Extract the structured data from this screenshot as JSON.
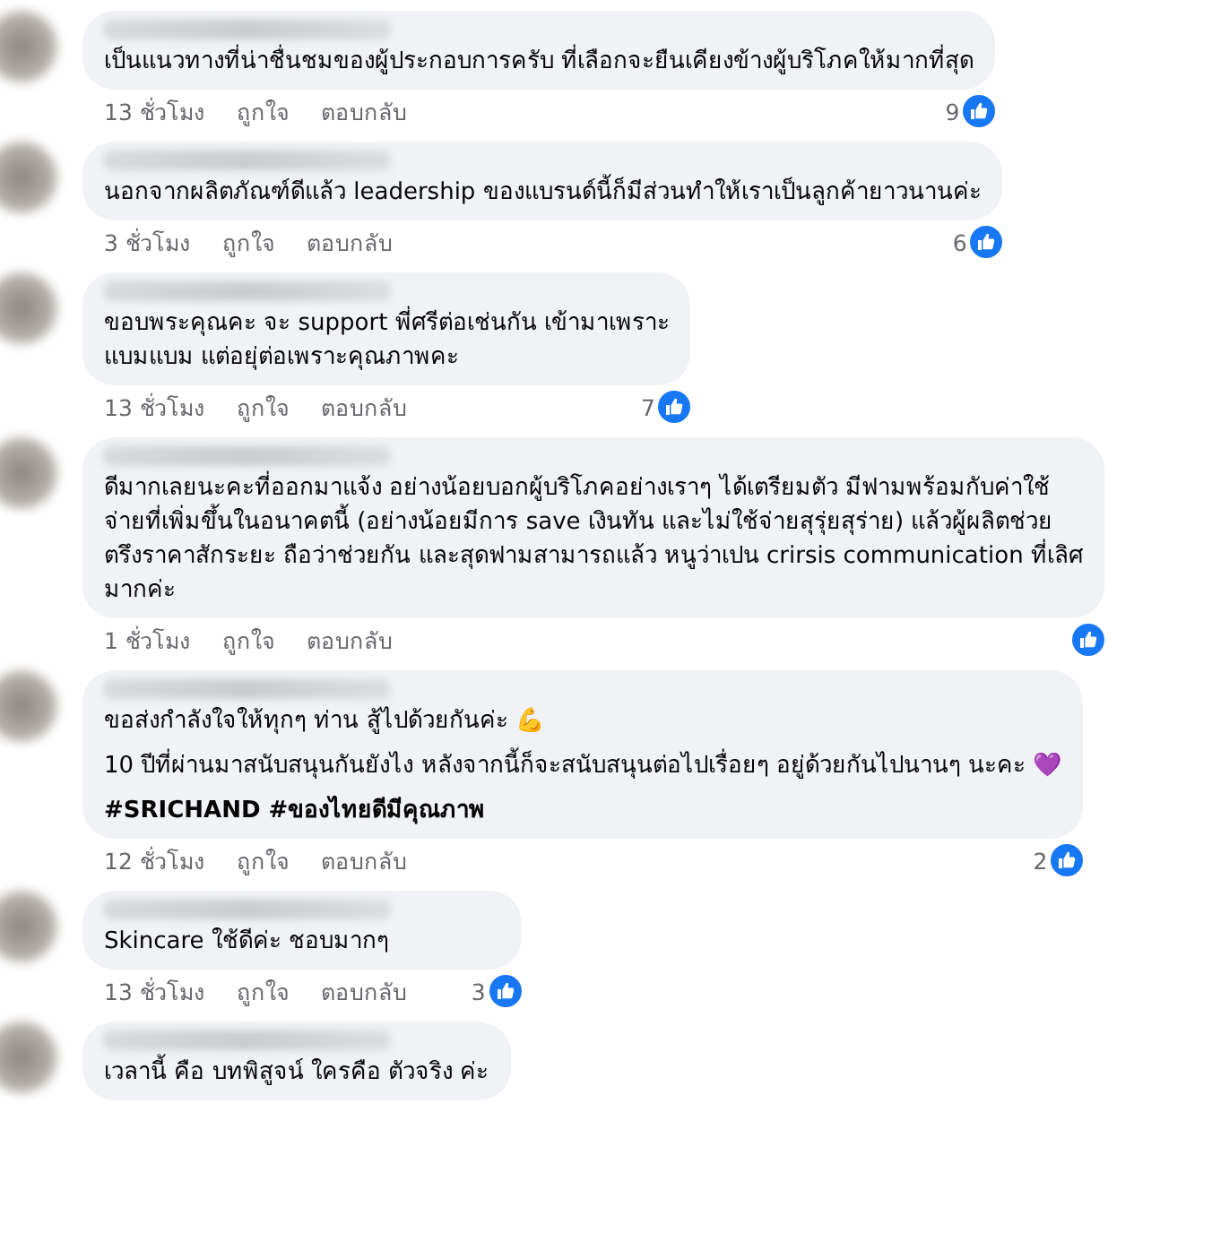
{
  "comments": [
    {
      "lines": [
        "เป็นแนวทางที่น่าชื่นชมของผู้ประกอบการครับ ที่เลือกจะยืนเคียงข้างผู้บริโภคให้มากที่สุด"
      ],
      "time": "13 ชั่วโมง",
      "like": "ถูกใจ",
      "reply": "ตอบกลับ",
      "likes": "9"
    },
    {
      "lines": [
        "นอกจากผลิตภัณฑ์ดีแล้ว leadership ของแบรนด์นี้ก็มีส่วนทำให้เราเป็นลูกค้ายาวนานค่ะ"
      ],
      "time": "3 ชั่วโมง",
      "like": "ถูกใจ",
      "reply": "ตอบกลับ",
      "likes": "6"
    },
    {
      "lines": [
        "ขอบพระคุณคะ จะ support พี่ศรีต่อเช่นกัน เข้ามาเพราะ",
        "แบมแบม แต่อยุ่ต่อเพราะคุณภาพคะ"
      ],
      "time": "13 ชั่วโมง",
      "like": "ถูกใจ",
      "reply": "ตอบกลับ",
      "likes": "7"
    },
    {
      "lines": [
        "ดีมากเลยนะคะที่ออกมาแจ้ง อย่างน้อยบอกผู้บริโภคอย่างเราๆ ได้เตรียมตัว มีฟามพร้อมกับค่าใช้",
        "จ่ายที่เพิ่มขึ้นในอนาคตนี้ (อย่างน้อยมีการ save เงินทัน และไม่ใช้จ่ายสุรุ่ยสุร่าย) แล้วผู้ผลิตช่วย",
        "ตรึงราคาสักระยะ ถือว่าช่วยกัน และสุดฟามสามารถแล้ว หนูว่าเปน crirsis communication ที่เลิศ",
        "มากค่ะ"
      ],
      "time": "1 ชั่วโมง",
      "like": "ถูกใจ",
      "reply": "ตอบกลับ"
    },
    {
      "lines": [
        "ขอส่งกำลังใจให้ทุกๆ ท่าน สู้ไปด้วยกันค่ะ 💪",
        "10 ปีที่ผ่านมาสนับสนุนกันยังไง หลังจากนี้ก็จะสนับสนุนต่อไปเรื่อยๆ อยู่ด้วยกันไปนานๆ นะคะ 💜",
        "**#SRICHAND #ของไทยดีมีคุณภาพ**"
      ],
      "time": "12 ชั่วโมง",
      "like": "ถูกใจ",
      "reply": "ตอบกลับ",
      "likes": "2"
    },
    {
      "lines": [
        "Skincare ใช้ดีค่ะ ชอบมากๆ"
      ],
      "time": "13 ชั่วโมง",
      "like": "ถูกใจ",
      "reply": "ตอบกลับ",
      "likes": "3"
    },
    {
      "lines": [
        "เวลานี้ คือ บทพิสูจน์ ใครคือ ตัวจริง ค่ะ"
      ]
    }
  ]
}
